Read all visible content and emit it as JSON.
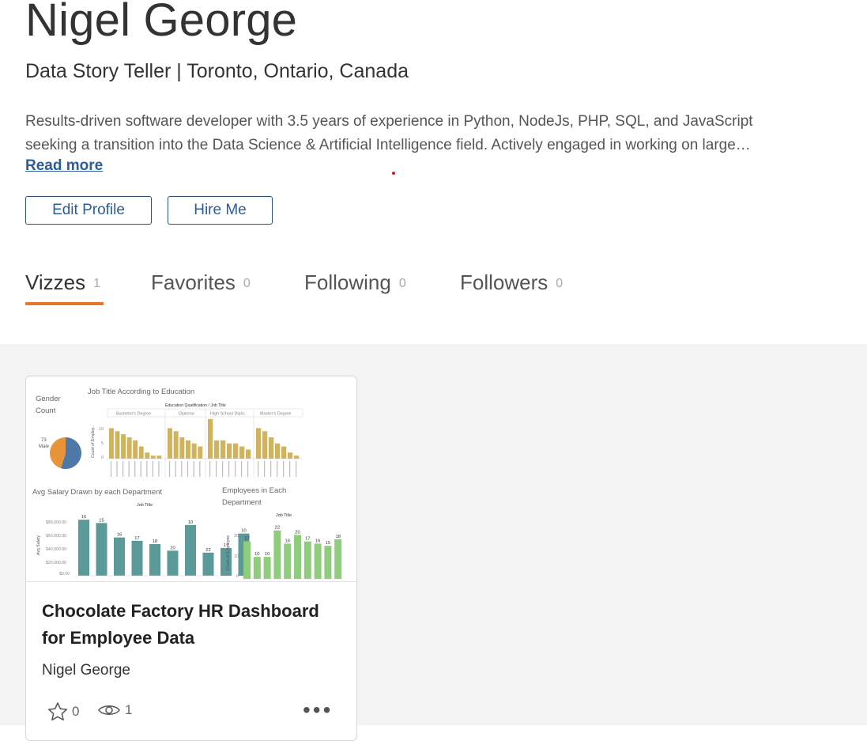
{
  "profile": {
    "name": "Nigel George",
    "tagline": "Data Story Teller | Toronto, Ontario, Canada",
    "bio_line1": "Results-driven software developer with 3.5 years of experience in Python, NodeJs, PHP, SQL, and JavaScript",
    "bio_line2": "seeking a transition into the Data Science & Artificial Intelligence field. Actively engaged in working on large…",
    "read_more": "Read more",
    "edit_profile": "Edit Profile",
    "hire_me": "Hire Me"
  },
  "tabs": [
    {
      "label": "Vizzes",
      "count": "1"
    },
    {
      "label": "Favorites",
      "count": "0"
    },
    {
      "label": "Following",
      "count": "0"
    },
    {
      "label": "Followers",
      "count": "0"
    }
  ],
  "card": {
    "title": "Chocolate Factory HR Dashboard for Employee Data",
    "author": "Nigel George",
    "favorites": "0",
    "views": "1",
    "thumbnail": {
      "gender_title_1": "Gender",
      "gender_title_2": "Count",
      "pie_label_value": "73",
      "pie_label_name": "Male",
      "job_title_heading": "Job Title According to Education",
      "edu_header": "Education Qualification  /  Job Title",
      "edu_groups": [
        "Bachelor's Degree",
        "Diploma",
        "High School Diplo..",
        "Master's Degree"
      ],
      "edu_ylabel": "Count of Employ..",
      "edu_ticks": [
        "10",
        "5",
        "0"
      ],
      "salary_heading": "Avg Salary Drawn by each Department",
      "salary_subheading": "Job Title",
      "salary_ylabel": "Avg Salary",
      "salary_ticks": [
        "$80,000.00",
        "$60,000.00",
        "$40,000.00",
        "$20,000.00",
        "$0.00"
      ],
      "emp_heading_1": "Employees in Each",
      "emp_heading_2": "Department",
      "emp_subheading": "Job Title",
      "emp_ylabel": "Count of Employee",
      "emp_ticks": [
        "20",
        "10",
        "0"
      ]
    }
  },
  "chart_data": [
    {
      "type": "pie",
      "title": "Gender Count",
      "slices": [
        {
          "name": "Male",
          "value": 73,
          "color": "#4e79a7"
        },
        {
          "name": "",
          "value": 60,
          "color": "#e8953a"
        }
      ]
    },
    {
      "type": "bar",
      "title": "Job Title According to Education",
      "groups": [
        "Bachelor's Degree",
        "Diploma",
        "High School Diplo..",
        "Master's Degree"
      ],
      "values": [
        [
          10,
          9,
          8,
          7,
          6,
          4,
          2,
          1,
          1
        ],
        [
          10,
          9,
          7,
          6,
          5,
          4
        ],
        [
          13,
          6,
          6,
          5,
          5,
          4,
          3
        ],
        [
          10,
          9,
          7,
          5,
          4,
          2,
          1
        ]
      ],
      "color": "#d0b35b",
      "ylim": [
        0,
        14
      ]
    },
    {
      "type": "bar",
      "title": "Avg Salary Drawn by each Department",
      "xlabel": "Job Title",
      "ylabel": "Avg Salary",
      "values": [
        85000,
        80000,
        58000,
        53000,
        48000,
        38000,
        77000,
        35000,
        42000,
        64000
      ],
      "labels": [
        "16",
        "15",
        "16",
        "17",
        "18",
        "20",
        "10",
        "22",
        "17",
        "10"
      ],
      "color": "#5b9a98",
      "ylim": [
        0,
        90000
      ]
    },
    {
      "type": "bar",
      "title": "Employees in Each Department",
      "xlabel": "Job Title",
      "ylabel": "Count of Employee",
      "values": [
        17,
        10,
        10,
        22,
        16,
        20,
        17,
        16,
        15,
        18
      ],
      "color": "#8fcc7d",
      "ylim": [
        0,
        28
      ]
    }
  ]
}
